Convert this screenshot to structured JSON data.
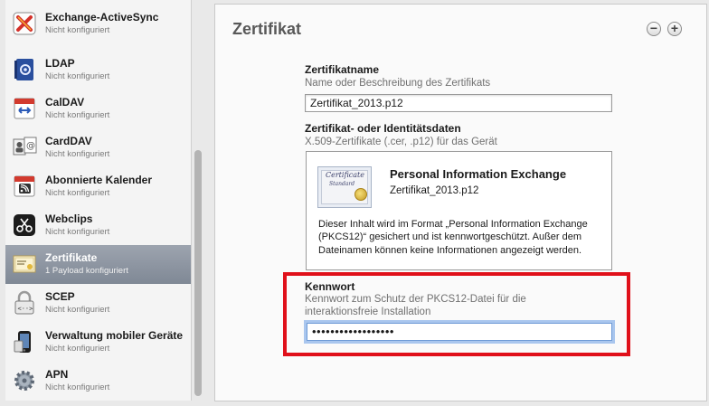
{
  "sidebar": {
    "items": [
      {
        "title": "Exchange-ActiveSync",
        "subtitle": "Nicht konfiguriert",
        "icon": "exchange-icon"
      },
      {
        "title": "LDAP",
        "subtitle": "Nicht konfiguriert",
        "icon": "ldap-address-book-icon"
      },
      {
        "title": "CalDAV",
        "subtitle": "Nicht konfiguriert",
        "icon": "caldav-calendar-icon"
      },
      {
        "title": "CardDAV",
        "subtitle": "Nicht konfiguriert",
        "icon": "carddav-contacts-icon"
      },
      {
        "title": "Abonnierte Kalender",
        "subtitle": "Nicht konfiguriert",
        "icon": "subscribed-calendar-icon"
      },
      {
        "title": "Webclips",
        "subtitle": "Nicht konfiguriert",
        "icon": "webclips-scissors-icon"
      },
      {
        "title": "Zertifikate",
        "subtitle": "1 Payload konfiguriert",
        "icon": "certificate-icon",
        "selected": true
      },
      {
        "title": "SCEP",
        "subtitle": "Nicht konfiguriert",
        "icon": "scep-lock-icon"
      },
      {
        "title": "Verwaltung mobiler Geräte",
        "subtitle": "Nicht konfiguriert",
        "icon": "mobile-device-management-icon"
      },
      {
        "title": "APN",
        "subtitle": "Nicht konfiguriert",
        "icon": "apn-gear-icon"
      }
    ]
  },
  "panel": {
    "title": "Zertifikat",
    "remove_button": "−",
    "add_button": "+"
  },
  "cert_name": {
    "label": "Zertifikatname",
    "description": "Name oder Beschreibung des Zertifikats",
    "value": "Zertifikat_2013.p12"
  },
  "cert_data": {
    "label": "Zertifikat- oder Identitätsdaten",
    "description": "X.509-Zertifikate (.cer, .p12) für das Gerät",
    "image_word1": "Certificate",
    "image_word2": "Standard",
    "type_title": "Personal Information Exchange",
    "file_name": "Zertifikat_2013.p12",
    "info": "Dieser Inhalt wird im Format „Personal Information Exchange (PKCS12)“ gesichert und ist kennwortgeschützt. Außer dem Dateinamen können keine Informationen angezeigt werden."
  },
  "password": {
    "label": "Kennwort",
    "description_line1": "Kennwort zum Schutz der PKCS12-Datei für die",
    "description_line2": "interaktionsfreie Installation",
    "value": "••••••••••••••••••"
  },
  "colors": {
    "highlight": "#e0101a",
    "selected_row": "#8b93a0",
    "focus_ring": "#a9c6ee"
  }
}
